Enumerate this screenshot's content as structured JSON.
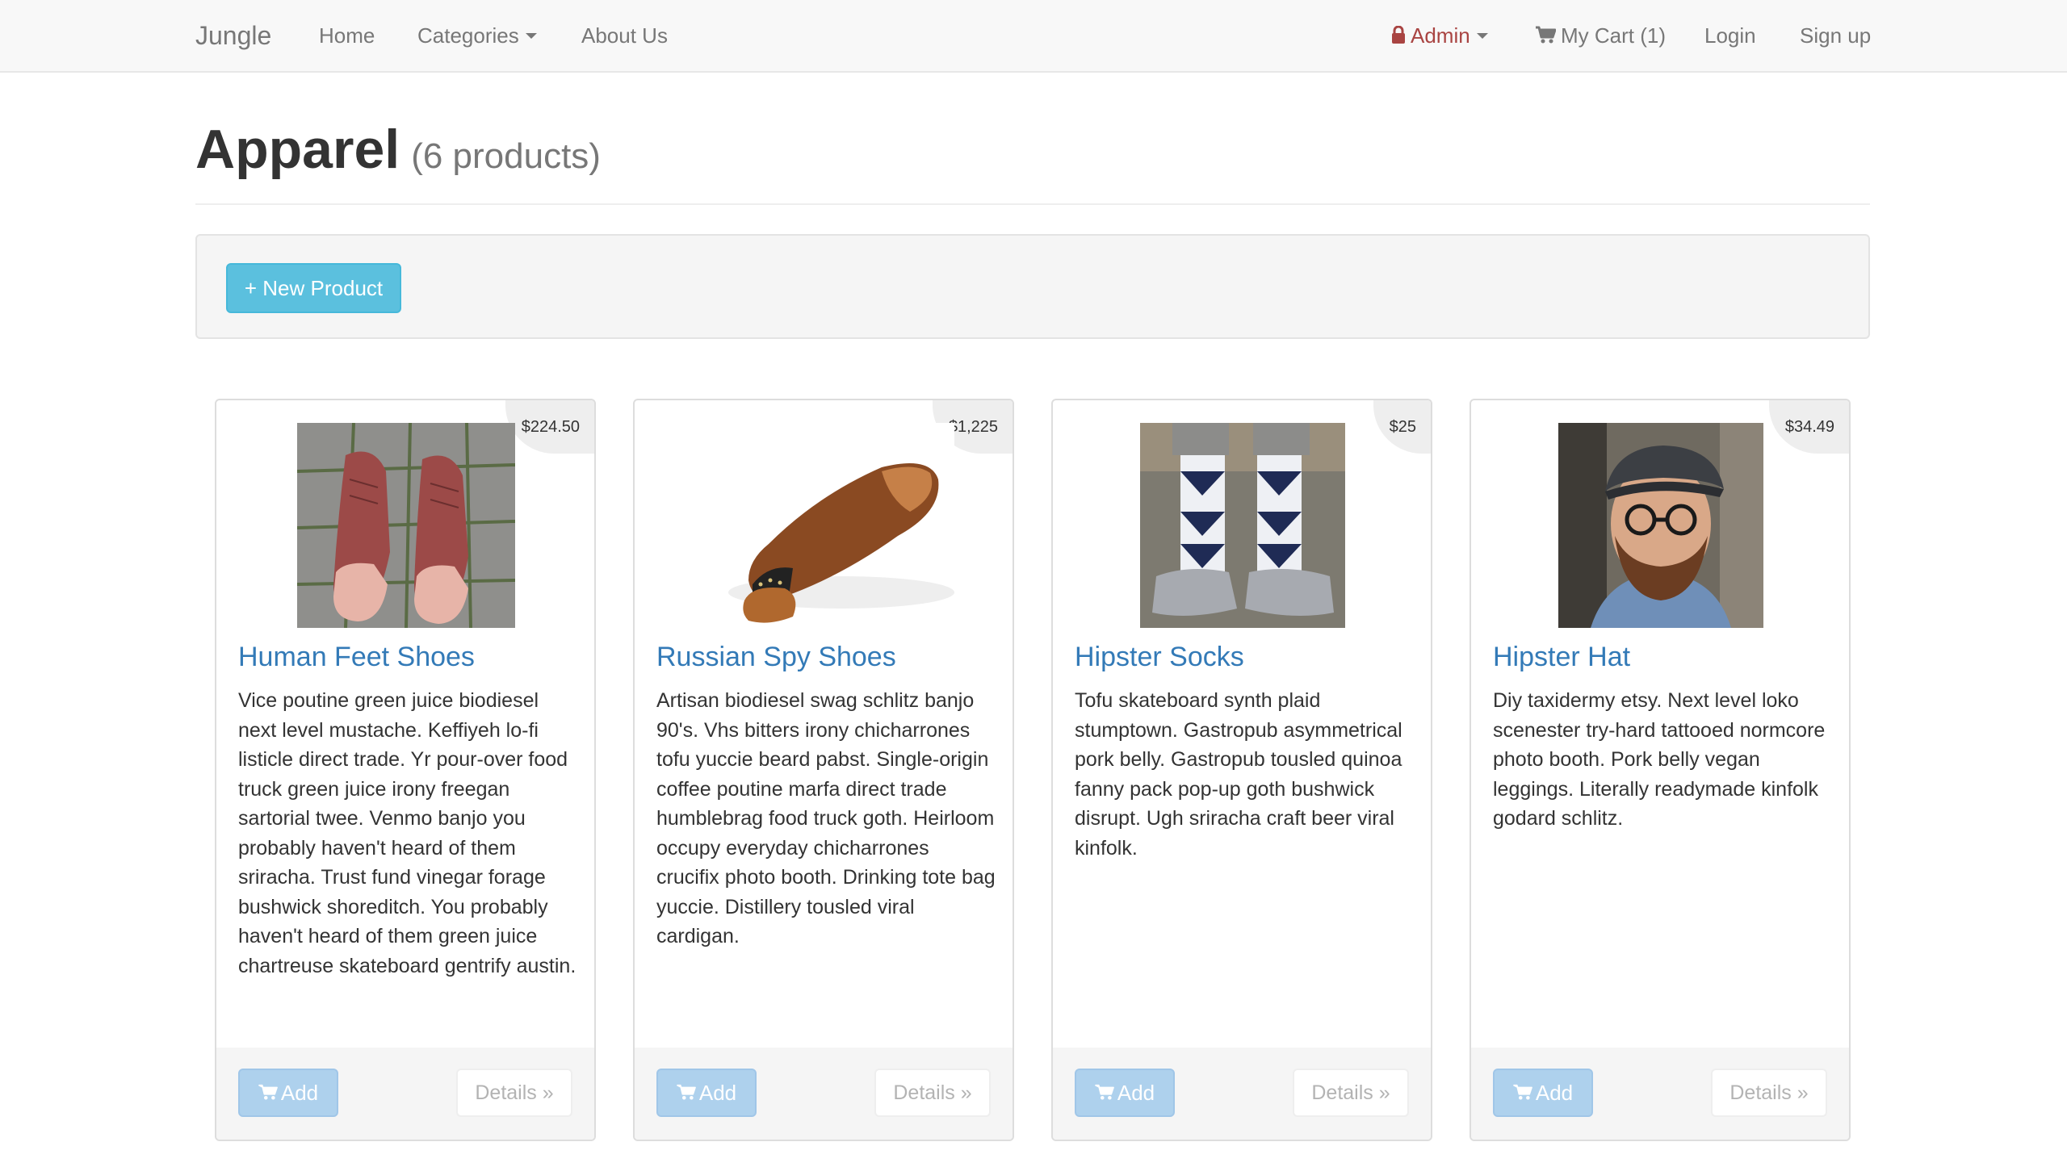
{
  "navbar": {
    "brand": "Jungle",
    "home": "Home",
    "categories": "Categories",
    "about": "About Us",
    "admin": "Admin",
    "cart": "My Cart (1)",
    "login": "Login",
    "signup": "Sign up",
    "colors": {
      "admin": "#a94442",
      "link": "#777777"
    }
  },
  "page": {
    "title": "Apparel",
    "count": "(6 products)",
    "new_product_label": "+ New Product"
  },
  "products": [
    {
      "name": "Human Feet Shoes",
      "price": "$224.50",
      "description": "Vice poutine green juice biodiesel next level mustache. Keffiyeh lo-fi listicle direct trade. Yr pour-over food truck green juice irony freegan sartorial twee. Venmo banjo you probably haven't heard of them sriracha. Trust fund vinegar forage bushwick shoreditch. You probably haven't heard of them green juice chartreuse skateboard gentrify austin.",
      "add_label": "Add",
      "details_label": "Details »",
      "image": "feet-shoes-photo"
    },
    {
      "name": "Russian Spy Shoes",
      "price": "$1,225",
      "description": "Artisan biodiesel swag schlitz banjo 90's. Vhs bitters irony chicharrones tofu yuccie beard pabst. Single-origin coffee poutine marfa direct trade humblebrag food truck goth. Heirloom occupy everyday chicharrones crucifix photo booth. Drinking tote bag yuccie. Distillery tousled viral cardigan.",
      "add_label": "Add",
      "details_label": "Details »",
      "image": "spy-shoe-photo"
    },
    {
      "name": "Hipster Socks",
      "price": "$25",
      "description": "Tofu skateboard synth plaid stumptown. Gastropub asymmetrical pork belly. Gastropub tousled quinoa fanny pack pop-up goth bushwick disrupt. Ugh sriracha craft beer viral kinfolk.",
      "add_label": "Add",
      "details_label": "Details »",
      "image": "socks-photo"
    },
    {
      "name": "Hipster Hat",
      "price": "$34.49",
      "description": "Diy taxidermy etsy. Next level loko scenester try-hard tattooed normcore photo booth. Pork belly vegan leggings. Literally readymade kinfolk godard schlitz.",
      "add_label": "Add",
      "details_label": "Details »",
      "image": "hat-man-photo"
    }
  ]
}
